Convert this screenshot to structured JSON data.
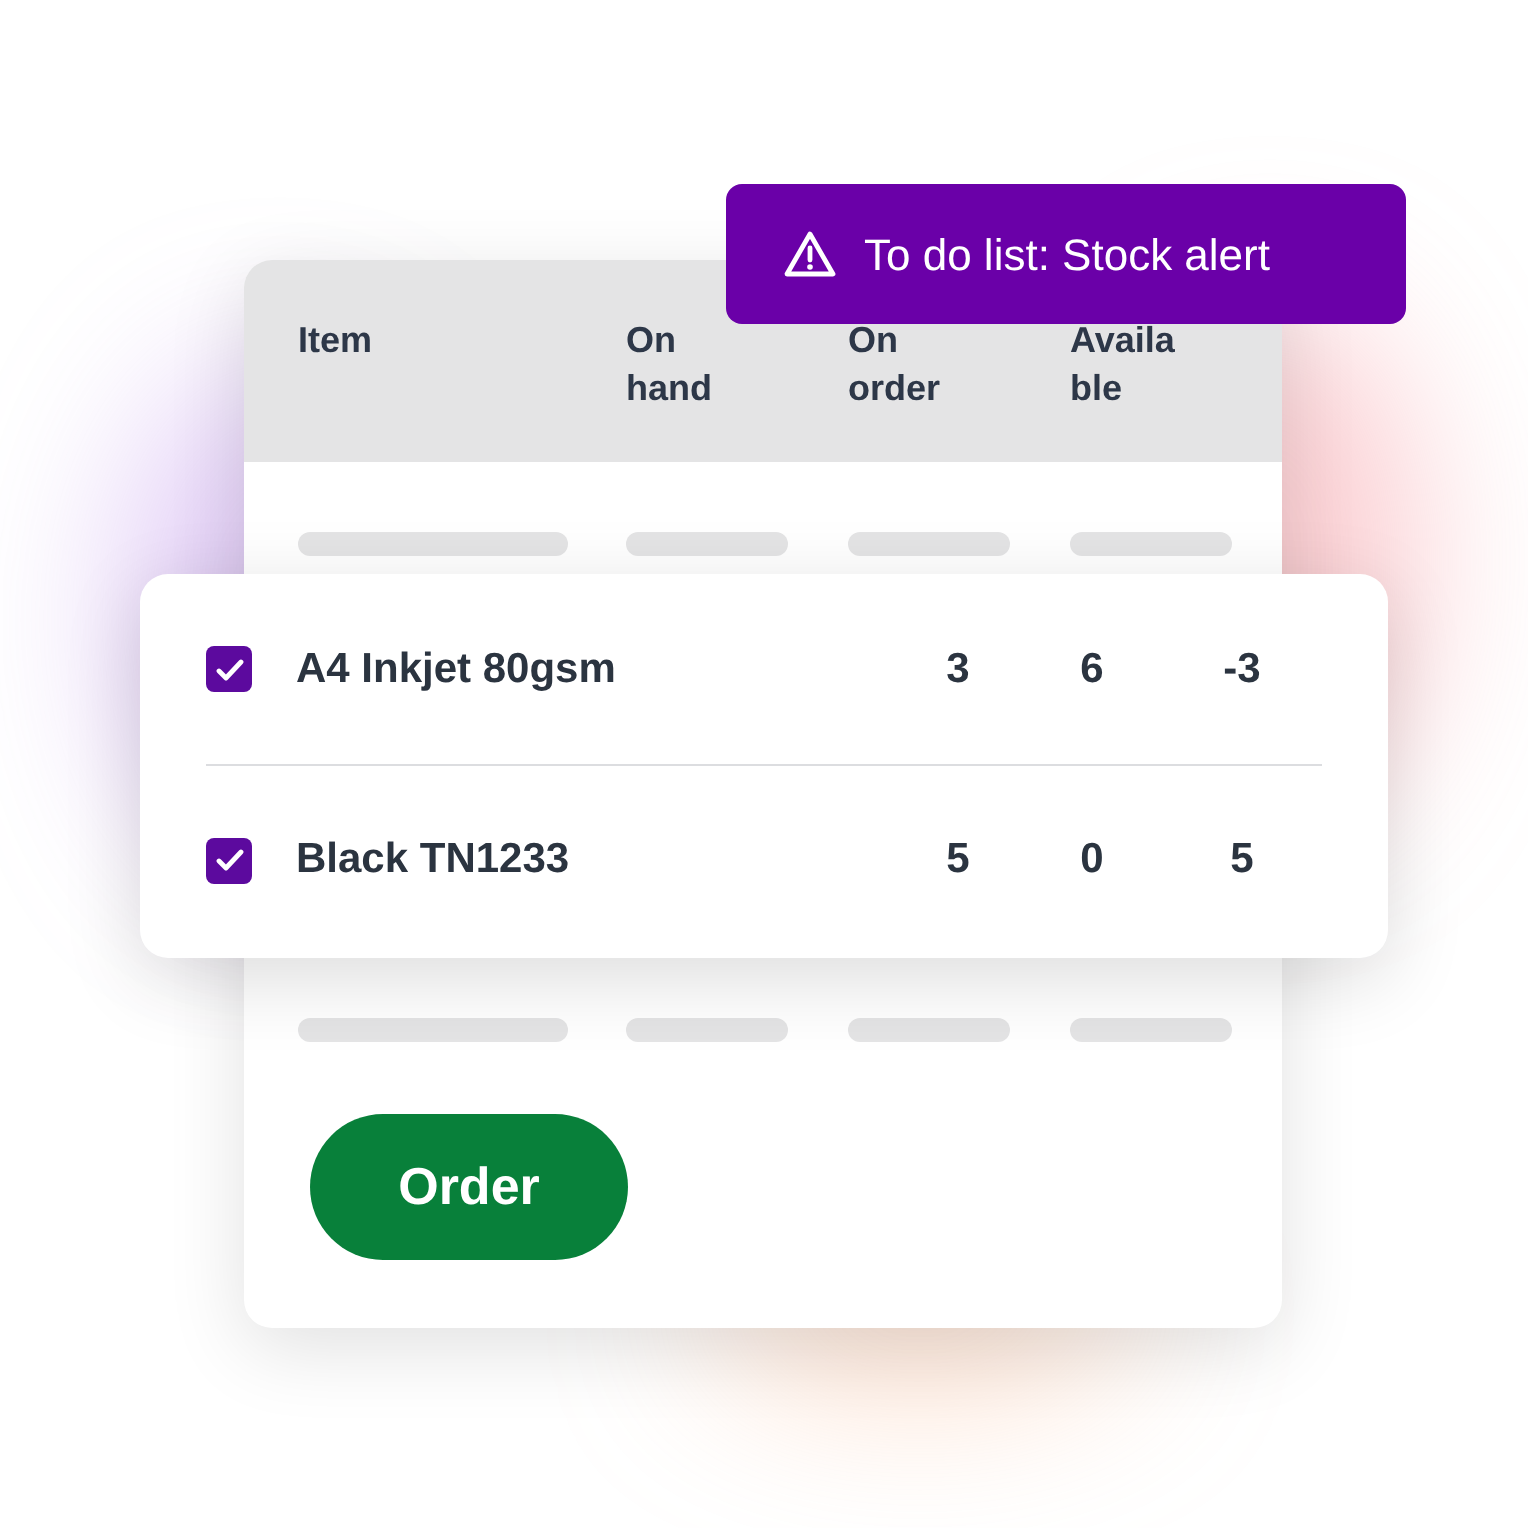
{
  "alert": {
    "text": "To do list: Stock alert"
  },
  "table": {
    "columns": [
      "Item",
      "On hand",
      "On order",
      "Available"
    ]
  },
  "rows": [
    {
      "checked": true,
      "item": "A4 Inkjet 80gsm",
      "on_hand": "3",
      "on_order": "6",
      "available": "-3"
    },
    {
      "checked": true,
      "item": "Black TN1233",
      "on_hand": "5",
      "on_order": "0",
      "available": "5"
    }
  ],
  "button": "Order"
}
